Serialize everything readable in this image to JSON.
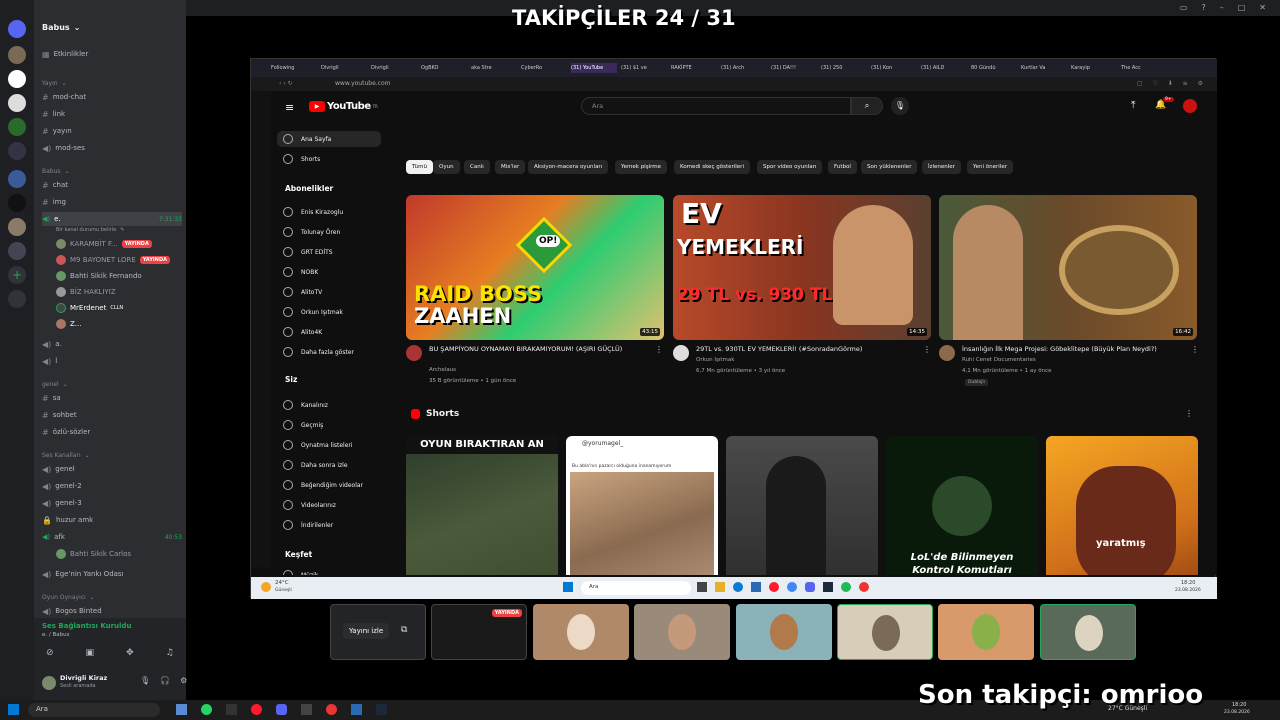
{
  "overlay": {
    "followers": "TAKİPÇİLER 24 / 31",
    "last_follower": "Son takipçi: omrioo"
  },
  "discord": {
    "server_name": "Babus",
    "events": "Etkinlikler",
    "cat_yayin": "Yayın",
    "channels_a": [
      "mod-chat",
      "link",
      "yayın",
      "mod-ses"
    ],
    "cat_babus": "Babus",
    "channels_b": [
      "chat",
      "img"
    ],
    "voice_e": "e.",
    "voice_e_time": "7:31:33",
    "voice_status": "Bir kanal durumu belirle",
    "users": [
      "KARAMBİT F...",
      "M9 BAYONET LORE",
      "Bahti Sikik Fernando",
      "BİZ HAKLIYIZ",
      "MrErdenet",
      "Z..."
    ],
    "live": "YAYINDA",
    "clln": "CLLN",
    "voice_a": "a.",
    "voice_l": "l",
    "cat_genel": "genel",
    "channels_c": [
      "sa",
      "sohbet",
      "özlü-sözler"
    ],
    "cat_ses": "Ses Kanalları",
    "voice_list": [
      "genel",
      "genel-2",
      "genel-3",
      "huzur amk"
    ],
    "afk": "afk",
    "afk_time": "40:53",
    "afk_user": "Bahti Sikik Carlos",
    "echo": "Ege'nin Yankı Odası",
    "cat_game": "Oyun Oynayıcı",
    "game_ch": "Bogos Binted",
    "voice_conn": "Ses Bağlantısı Kuruldu",
    "voice_conn_sub": "e. / Babus",
    "me_name": "Divrigli Kiraz",
    "me_status": "Sesli aramada"
  },
  "browser": {
    "tabs": [
      "Following",
      "Divrigli",
      "Divrigli",
      "OgBKO",
      "aka Stre",
      "CyberRo",
      "(31) YouTube",
      "(31) $1 ve",
      "RAKİPTE",
      "(31) Arch",
      "(31) DA!!!",
      "(31) 250",
      "(31) Kon",
      "(31) AILD",
      "80 Gündü",
      "Kurtlar Va",
      "Karayip",
      "The Acc"
    ],
    "url": "www.youtube.com"
  },
  "yt": {
    "logo": "YouTube",
    "logo_sup": "TR",
    "search_placeholder": "Ara",
    "notif": "9+",
    "nav": [
      "Ana Sayfa",
      "Shorts"
    ],
    "subs_head": "Abonelikler",
    "subs": [
      "Enis Kirazoglu",
      "Tolunay Ören",
      "GRT EDİTS",
      "NOBK",
      "AlitoTV",
      "Orkun Işıtmak",
      "Alito4K",
      "Daha fazla göster"
    ],
    "you_head": "Siz",
    "you": [
      "Kanalınız",
      "Geçmiş",
      "Oynatma listeleri",
      "Daha sonra izle",
      "Beğendiğim videolar",
      "Videolarınız",
      "İndirilenler"
    ],
    "explore": "Keşfet",
    "music": "Müzik",
    "chips": [
      "Tümü",
      "Oyun",
      "Canlı",
      "Mix'ler",
      "Aksiyon-macera oyunları",
      "Yemek pişirme",
      "Komedi skeç gösterileri",
      "Spor video oyunları",
      "Futbol",
      "Son yüklenenler",
      "İzlenenler",
      "Yeni öneriler"
    ],
    "videos": [
      {
        "title": "BU ŞAMPİYONU OYNAMAYI BIRAKAMIYORUM! (AŞIRI GÜÇLÜ)",
        "channel": "Archelaus",
        "meta": "35 B görüntüleme • 1 gün önce",
        "dur": "43:15",
        "t1": "RAID BOSS",
        "t2": "ZAAHEN",
        "t3": "OP!"
      },
      {
        "title": "29TL vs. 930TL EV YEMEKLERİ! (#SonradanGörme)",
        "channel": "Orkun Işıtmak",
        "meta": "6,7 Mn görüntüleme • 3 yıl önce",
        "dur": "14:35",
        "t1": "EV",
        "t2": "YEMEKLERİ",
        "t3": "29 TL vs. 930 TL"
      },
      {
        "title": "İnsanlığın İlk Mega Projesi: Göbeklitepe (Büyük Plan Neydi?)",
        "channel": "Ruhi Cenet Documentaries",
        "meta": "4,1 Mn görüntüleme • 1 ay önce",
        "dur": "16:42",
        "badge": "Dublajlı"
      }
    ],
    "shorts_head": "Shorts",
    "shorts": [
      "OYUN BIRAKTIRAN AN",
      "@yorumagel_",
      "",
      "LoL'de Bilinmeyen Kontrol Komutları",
      "yaratmış"
    ],
    "short2_caption": "Bu abla'nın pazarcı olduğuna inanamıyorum"
  },
  "taskbar_inner": {
    "weather": "24°C",
    "weather_sub": "Güneşli",
    "search": "Ara",
    "time": "18:20",
    "date": "23.08.2026"
  },
  "stream": {
    "watch": "Yayını izle",
    "live": "YAYINDA"
  },
  "taskbar": {
    "search": "Ara",
    "weather": "27°C Güneşli",
    "time": "18:20",
    "date": "23.08.2026"
  },
  "colors": {
    "yt_red": "#ff0000",
    "discord_bg": "#2b2d31",
    "live_red": "#ed4245",
    "green": "#23a55a"
  }
}
